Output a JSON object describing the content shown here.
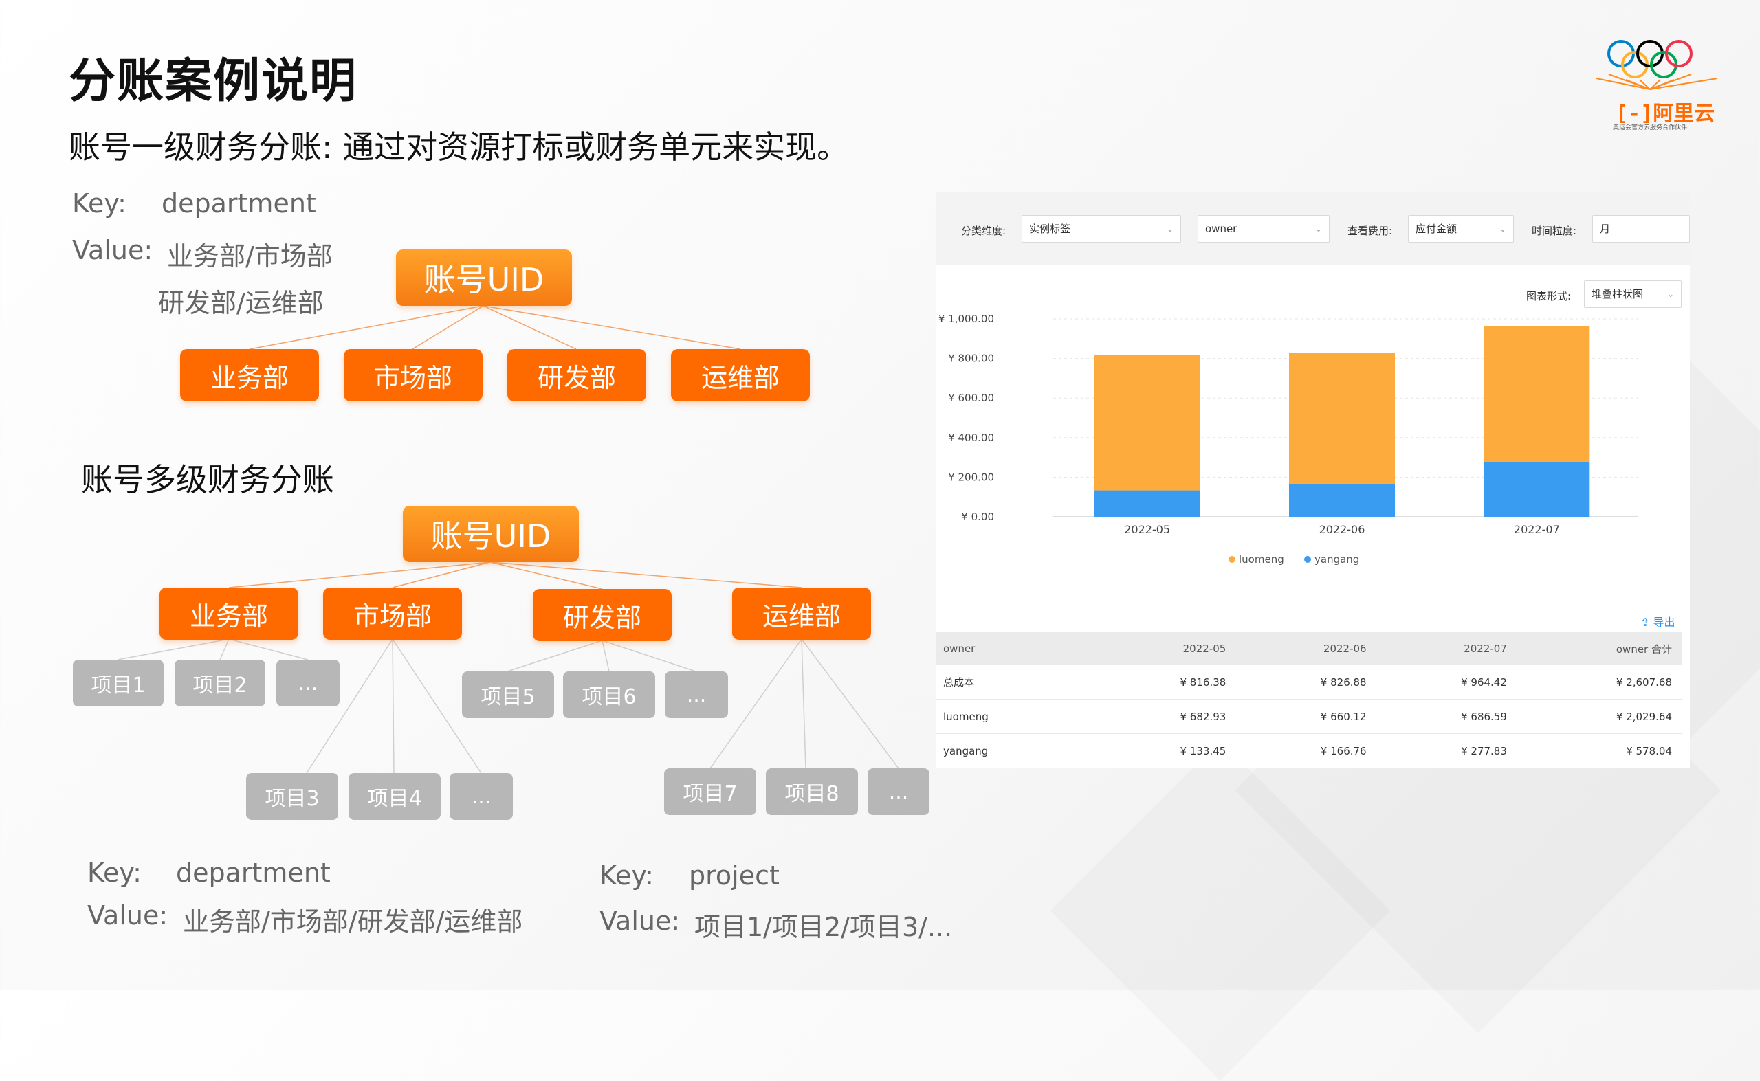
{
  "header": {
    "title": "分账案例说明",
    "subtitle": "账号一级财务分账: 通过对资源打标或财务单元来实现。"
  },
  "top_keys": {
    "key_label": "Key:",
    "key_value": "department",
    "value_label": "Value:",
    "value_line1": "业务部/市场部",
    "value_line2": "研发部/运维部"
  },
  "tree1": {
    "root": "账号UID",
    "depts": [
      "业务部",
      "市场部",
      "研发部",
      "运维部"
    ]
  },
  "section2_title": "账号多级财务分账",
  "tree2": {
    "root": "账号UID",
    "depts": [
      "业务部",
      "市场部",
      "研发部",
      "运维部"
    ],
    "projects": [
      "项目1",
      "项目2",
      "...",
      "项目3",
      "项目4",
      "...",
      "项目5",
      "项目6",
      "...",
      "项目7",
      "项目8",
      "..."
    ]
  },
  "bottom_left": {
    "key_label": "Key:",
    "key_value": "department",
    "value_label": "Value:",
    "value_text": "业务部/市场部/研发部/运维部"
  },
  "bottom_right": {
    "key_label": "Key:",
    "key_value": "project",
    "value_label": "Value:",
    "value_text": "项目1/项目2/项目3/..."
  },
  "logo": {
    "brand_text": "阿里云",
    "tagline": "奥运会官方云服务合作伙伴",
    "ring_colors": [
      "#0081c8",
      "#fcb131",
      "#000000",
      "#00a651",
      "#ee334e"
    ]
  },
  "panel": {
    "filters": {
      "dimension_label": "分类维度:",
      "dimension_value": "实例标签",
      "tag_value": "owner",
      "cost_label": "查看费用:",
      "cost_value": "应付金额",
      "granularity_label": "时间粒度:",
      "granularity_value": "月"
    },
    "chart_form_label": "图表形式:",
    "chart_form_value": "堆叠柱状图",
    "export_label": "导出",
    "table": {
      "headers": [
        "owner",
        "2022-05",
        "2022-06",
        "2022-07",
        "owner 合计"
      ],
      "rows": [
        [
          "总成本",
          "¥ 816.38",
          "¥ 826.88",
          "¥ 964.42",
          "¥ 2,607.68"
        ],
        [
          "luomeng",
          "¥ 682.93",
          "¥ 660.12",
          "¥ 686.59",
          "¥ 2,029.64"
        ],
        [
          "yangang",
          "¥ 133.45",
          "¥ 166.76",
          "¥ 277.83",
          "¥ 578.04"
        ]
      ]
    }
  },
  "chart_data": {
    "type": "bar",
    "stacked": true,
    "categories": [
      "2022-05",
      "2022-06",
      "2022-07"
    ],
    "series": [
      {
        "name": "luomeng",
        "values": [
          682.93,
          660.12,
          686.59
        ],
        "color": "#fdab3d"
      },
      {
        "name": "yangang",
        "values": [
          133.45,
          166.76,
          277.83
        ],
        "color": "#3a9cf0"
      }
    ],
    "y_ticks": [
      "¥ 0.00",
      "¥ 200.00",
      "¥ 400.00",
      "¥ 600.00",
      "¥ 800.00",
      "¥ 1,000.00"
    ],
    "ylim": [
      0,
      1000
    ],
    "grid": true,
    "legend_position": "bottom"
  }
}
